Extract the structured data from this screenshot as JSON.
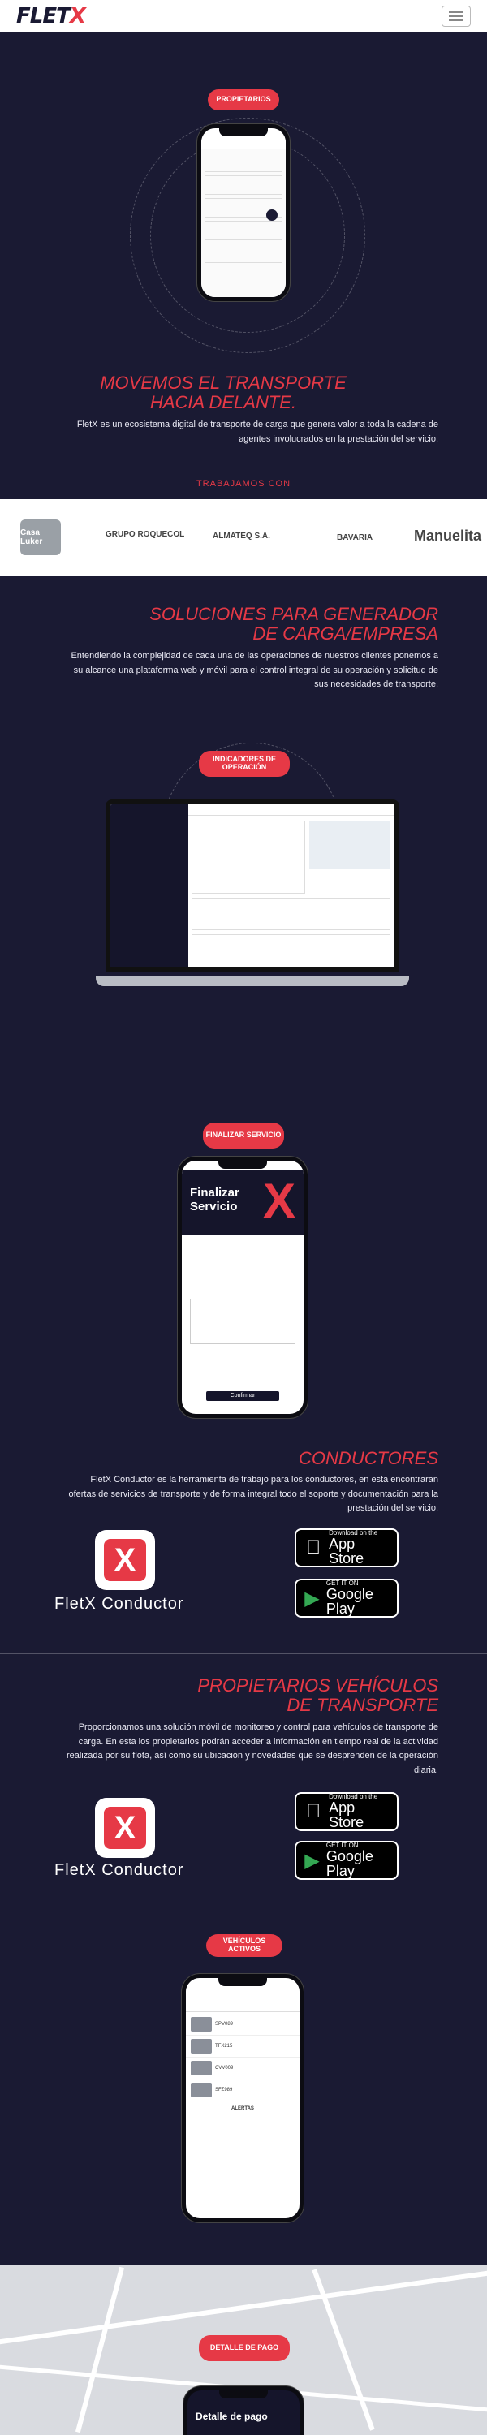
{
  "header": {
    "brand_main": "FLET",
    "brand_x": "X"
  },
  "hero": {
    "pill": "PROPIETARIOS",
    "heading_line1": "MOVEMOS EL TRANSPORTE",
    "heading_line2": "HACIA DELANTE.",
    "description": "FletX es un ecosistema digital de transporte de carga que genera valor a toda la cadena de agentes involucrados en la prestación del servicio.",
    "partners_title": "TRABAJAMOS CON"
  },
  "partners": [
    "Casa Luker",
    "GRUPO ROQUECOL",
    "ALMATEQ S.A.",
    "BAVARIA",
    "Manuelita"
  ],
  "solutions": {
    "heading_line1": "SOLUCIONES PARA GENERADOR",
    "heading_line2": "DE CARGA/EMPRESA",
    "description": "Entendiendo la complejidad de cada una de las operaciones de nuestros clientes ponemos a su alcance una plataforma web y móvil para el control integral de su operación y solicitud de sus necesidades de transporte.",
    "pill": "INDICADORES DE OPERACIÓN"
  },
  "conductores": {
    "pill": "FINALIZAR SERVICIO",
    "phone_title": "Finalizar Servicio",
    "phone_button": "Confirmar",
    "heading": "CONDUCTORES",
    "description": "FletX Conductor es la herramienta de trabajo para los conductores, en esta encontraran ofertas de servicios de transporte y de forma integral todo el soporte y documentación para la prestación del servicio.",
    "app_name": "FletX Conductor"
  },
  "propietarios": {
    "heading_line1": "PROPIETARIOS VEHÍCULOS",
    "heading_line2": "DE TRANSPORTE",
    "description": "Proporcionamos una solución móvil de monitoreo y control para vehículos de transporte de carga. En esta los propietarios podrán acceder a información en tiempo real de la actividad realizada por su flota, así como su ubicación y novedades que se desprenden de la operación diaria.",
    "app_name": "FletX Conductor",
    "pill": "VEHÍCULOS ACTIVOS",
    "plates": [
      "SPV089",
      "TFX215",
      "CVV009",
      "SFZ989"
    ],
    "section_label": "ALERTAS"
  },
  "stores": {
    "apple_small": "Download on the",
    "apple_big": "App Store",
    "google_small": "GET IT ON",
    "google_big": "Google Play"
  },
  "payment": {
    "pill": "DETALLE DE PAGO",
    "phone_title": "Detalle de pago"
  },
  "colors": {
    "navy": "#1a1a33",
    "red": "#e63946",
    "white": "#ffffff"
  }
}
